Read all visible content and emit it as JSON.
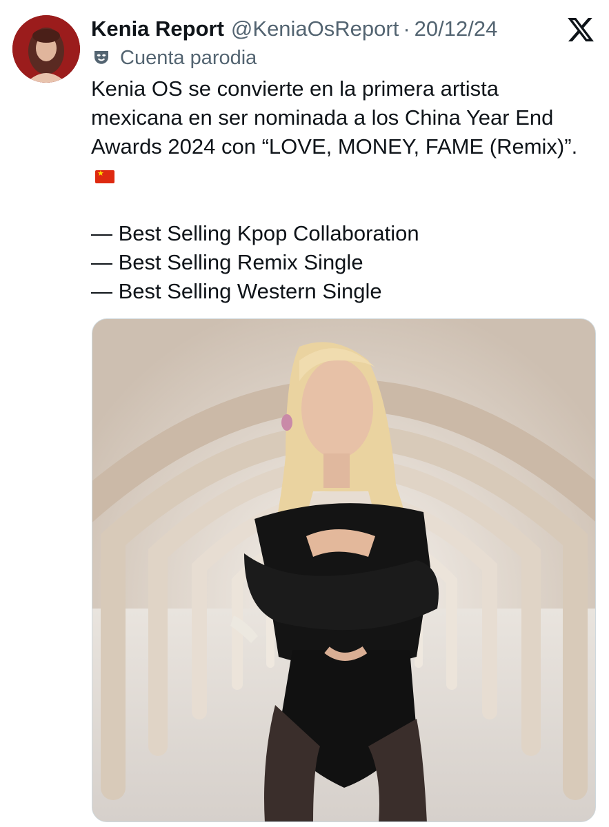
{
  "author": {
    "display_name": "Kenia Report",
    "handle": "@KeniaOsReport",
    "separator": "·",
    "date": "20/12/24",
    "label": "Cuenta parodia"
  },
  "tweet": {
    "text": "Kenia OS se convierte en la primera artista mexicana en ser nominada a los China Year End Awards 2024 con “LOVE, MONEY, FAME (Remix)”.",
    "flag_icon": "china-flag-emoji",
    "categories": [
      "— Best Selling Kpop Collaboration",
      "— Best Selling Remix Single",
      "— Best Selling Western Single"
    ]
  },
  "icons": {
    "brand": "x-logo-icon",
    "parody": "theater-mask-icon"
  },
  "colors": {
    "text": "#0f1419",
    "secondary": "#536471",
    "flag_red": "#de2910",
    "flag_star": "#ffde00"
  }
}
